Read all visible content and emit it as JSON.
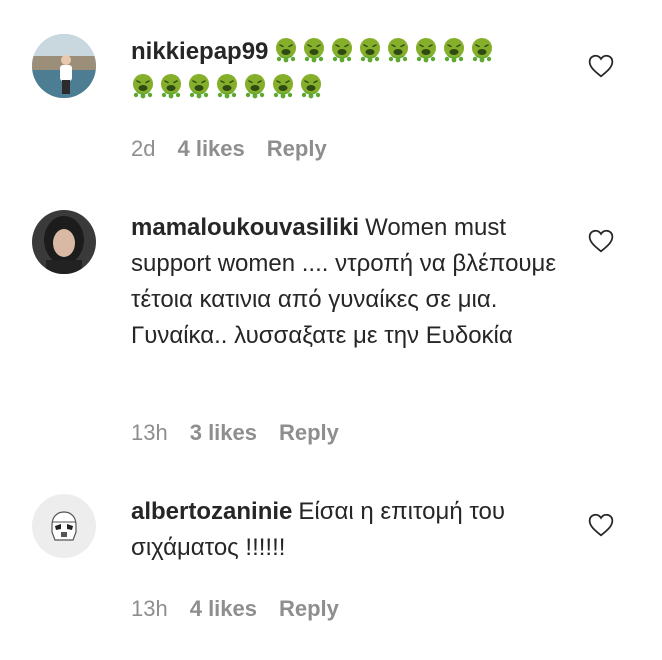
{
  "comments": [
    {
      "username": "nikkiepap99",
      "text": "",
      "emoji": "🤮",
      "emoji_count_line1": 8,
      "emoji_count_line2": 7,
      "time": "2d",
      "likes": "4 likes",
      "reply_label": "Reply"
    },
    {
      "username": "mamaloukouvasiliki",
      "text": "Women must support women .... ντροπή να βλέπουμε τέτοια κατινια από γυναίκες σε μια. Γυναίκα.. λυσσαξατε με την Ευδοκία",
      "time": "13h",
      "likes": "3 likes",
      "reply_label": "Reply"
    },
    {
      "username": "albertozaninie",
      "text": "Είσαι η επιτομή του σιχάματος !!!!!!",
      "time": "13h",
      "likes": "4 likes",
      "reply_label": "Reply"
    }
  ],
  "colors": {
    "text": "#262626",
    "secondary": "#8e8e8e",
    "emoji_green": "#5fa830",
    "emoji_yellow": "#f7c21a"
  },
  "icons": {
    "like": "heart-outline-icon",
    "vomit": "face-vomiting-emoji"
  }
}
